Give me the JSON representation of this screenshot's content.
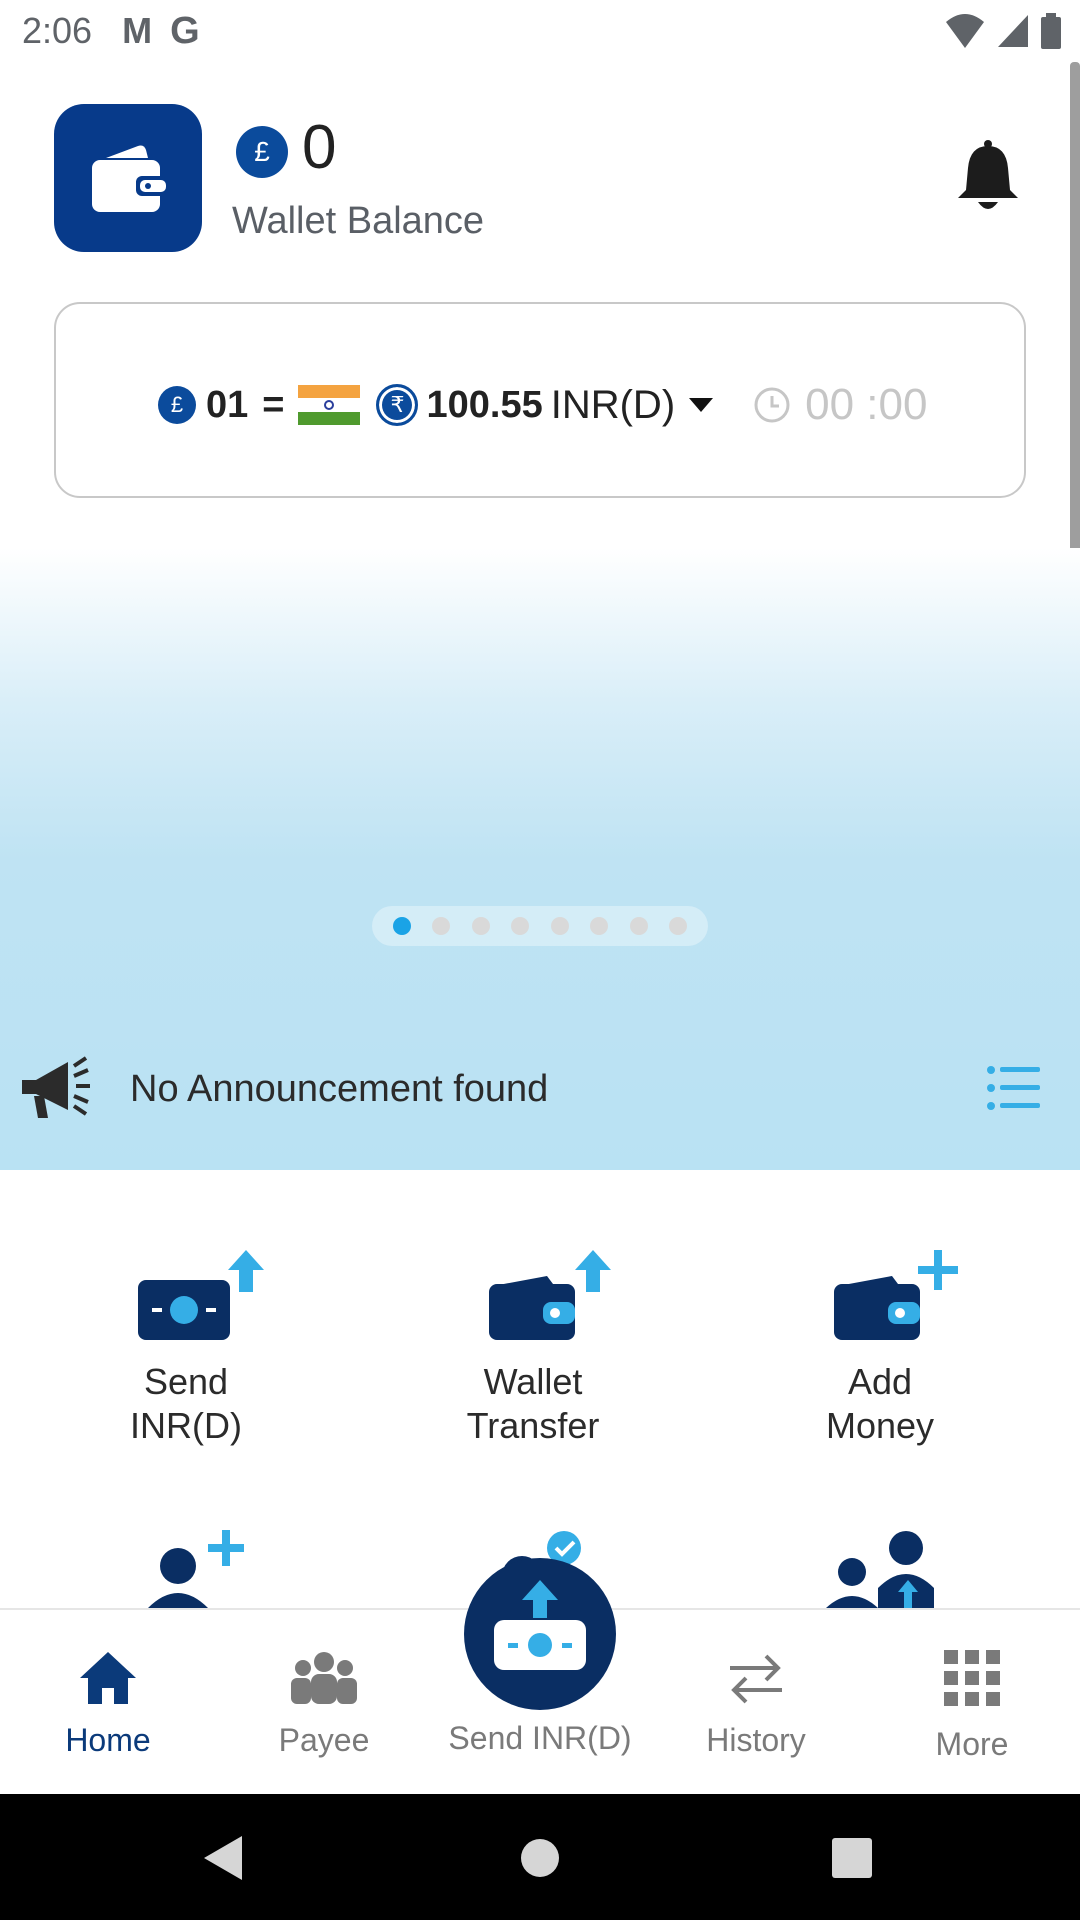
{
  "status_bar": {
    "time": "2:06",
    "app_icons": [
      "gmail-icon",
      "google-icon"
    ],
    "app_glyph_1": "M",
    "app_glyph_2": "G",
    "right_icons": [
      "wifi-icon",
      "signal-icon",
      "battery-icon"
    ]
  },
  "header": {
    "currency_symbol": "£",
    "balance": "0",
    "balance_label": "Wallet Balance"
  },
  "rate": {
    "from_symbol": "£",
    "from_amount": "01",
    "equals": "=",
    "to_symbol": "₹",
    "to_amount": "100.55",
    "to_currency": "INR(D)",
    "timer": "00 :00"
  },
  "carousel": {
    "total": 8,
    "active_index": 0
  },
  "announcement": {
    "text": "No Announcement found"
  },
  "actions": [
    {
      "label_line1": "Send",
      "label_line2": "INR(D)"
    },
    {
      "label_line1": "Wallet",
      "label_line2": "Transfer"
    },
    {
      "label_line1": "Add",
      "label_line2": "Money"
    }
  ],
  "bottom_nav": [
    {
      "label": "Home",
      "active": true
    },
    {
      "label": "Payee",
      "active": false
    },
    {
      "label": "Send INR(D)",
      "active": false
    },
    {
      "label": "History",
      "active": false
    },
    {
      "label": "More",
      "active": false
    }
  ],
  "colors": {
    "primary_dark": "#0a2e63",
    "primary": "#073a8a",
    "accent": "#35aee6",
    "banner": "#b9e2f3"
  }
}
